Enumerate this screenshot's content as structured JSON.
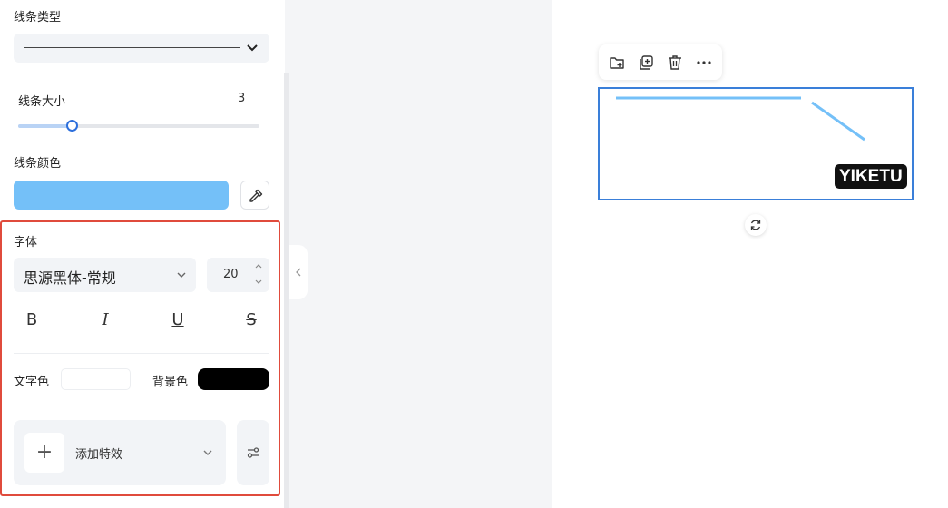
{
  "line_type": {
    "label": "线条类型"
  },
  "line_size": {
    "label": "线条大小",
    "value": "3",
    "fraction": 0.22
  },
  "line_color": {
    "label": "线条颜色",
    "color": "#74c0f8"
  },
  "font": {
    "label": "字体",
    "family": "思源黑体-常规",
    "size": "20",
    "buttons": {
      "bold": "B",
      "italic": "I",
      "underline": "U",
      "strike": "S"
    },
    "text_color_label": "文字色",
    "text_color": "#ffffff",
    "bg_color_label": "背景色",
    "bg_color": "#000000"
  },
  "effect": {
    "plus": "+",
    "label": "添加特效"
  },
  "canvas": {
    "watermark": "YIKETU",
    "line_color": "#74c0f8"
  },
  "colors": {
    "accent": "#2d6fdc",
    "highlight_border": "#e04b3c"
  },
  "icons": {
    "toolbar": [
      "folder-add-icon",
      "duplicate-icon",
      "trash-icon",
      "more-icon"
    ],
    "misc": [
      "chevron-down-icon",
      "eyedropper-icon",
      "settings-sliders-icon",
      "chevron-left-icon",
      "rotate-icon"
    ]
  }
}
